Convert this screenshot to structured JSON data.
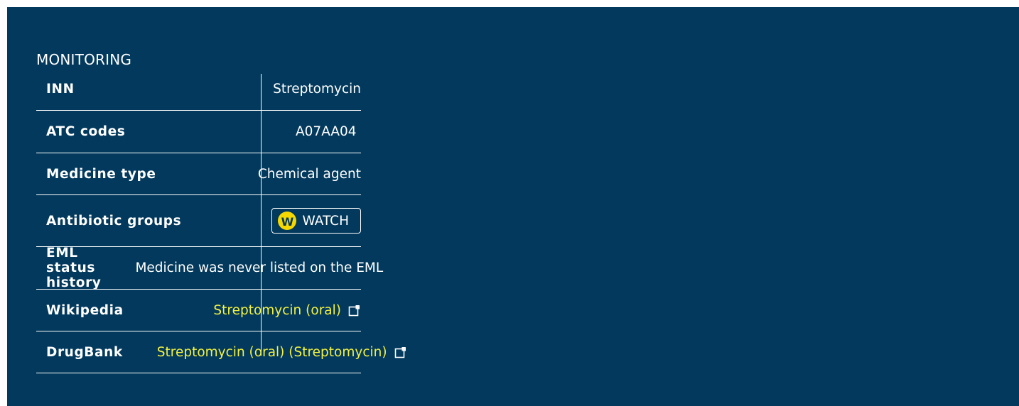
{
  "section": {
    "title": "MONITORING"
  },
  "rows": [
    {
      "label": "INN",
      "value": "Streptomycin"
    },
    {
      "label": "ATC codes",
      "value": "A07AA04"
    },
    {
      "label": "Medicine type",
      "value": "Chemical agent"
    },
    {
      "label": "Antibiotic groups",
      "badge_letter": "W",
      "badge_text": "WATCH"
    },
    {
      "label": "EML status history",
      "value": "Medicine was never listed on the EML"
    },
    {
      "label": "Wikipedia",
      "link": "Streptomycin (oral)"
    },
    {
      "label": "DrugBank",
      "link": "Streptomycin (oral) (Streptomycin)"
    }
  ],
  "colors": {
    "background": "#02395c",
    "link": "#f4f140",
    "watch_badge": "#f4d800",
    "text": "#ffffff"
  },
  "icons": {
    "external_link": "external-link-icon",
    "watch": "watch-circle-icon"
  }
}
